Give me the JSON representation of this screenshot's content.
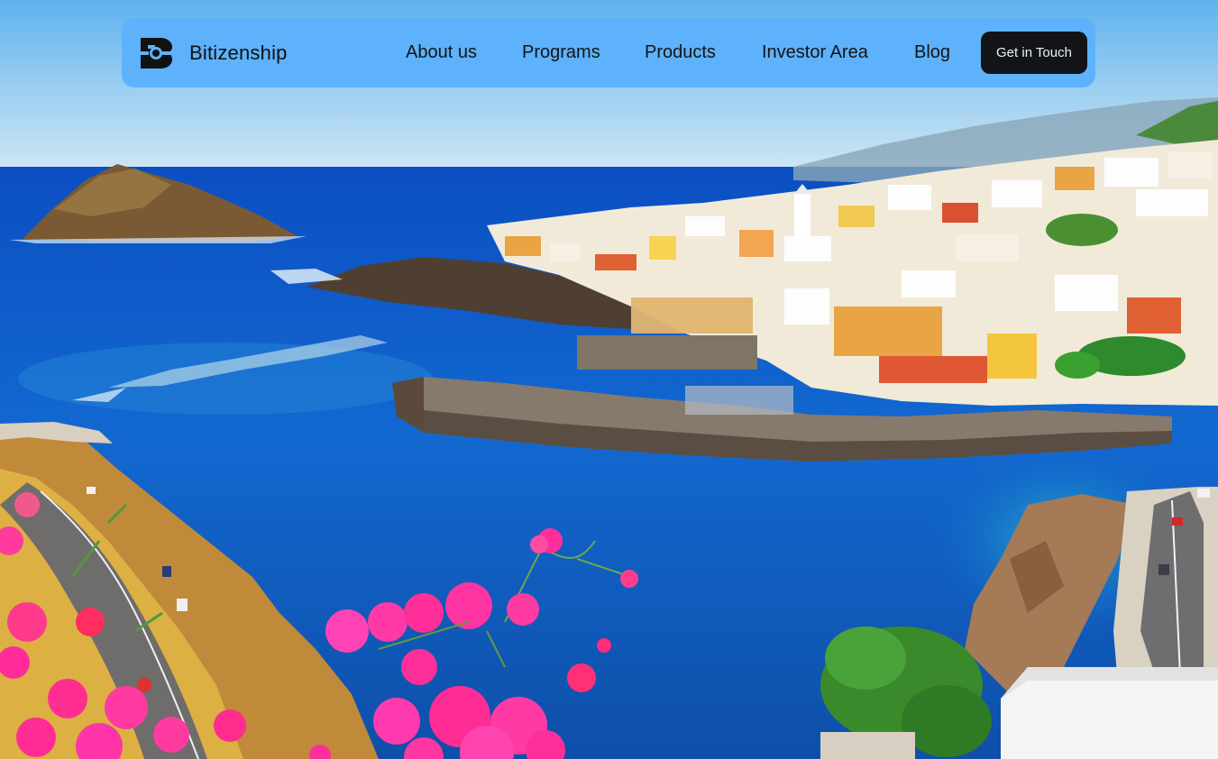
{
  "brand": {
    "name": "Bitizenship",
    "logo_icon": "bitizenship-logo-icon"
  },
  "nav": {
    "items": [
      {
        "label": "About us"
      },
      {
        "label": "Programs"
      },
      {
        "label": "Products"
      },
      {
        "label": "Investor Area"
      },
      {
        "label": "Blog"
      }
    ],
    "cta_label": "Get in Touch"
  },
  "colors": {
    "navbar_bg": "#5db2fb",
    "cta_bg": "#121417",
    "cta_text": "#e8f2ff",
    "sea": "#1368cf",
    "sky": "#a9d2ef"
  },
  "hero": {
    "image": "coastal-town-bay-photo"
  }
}
